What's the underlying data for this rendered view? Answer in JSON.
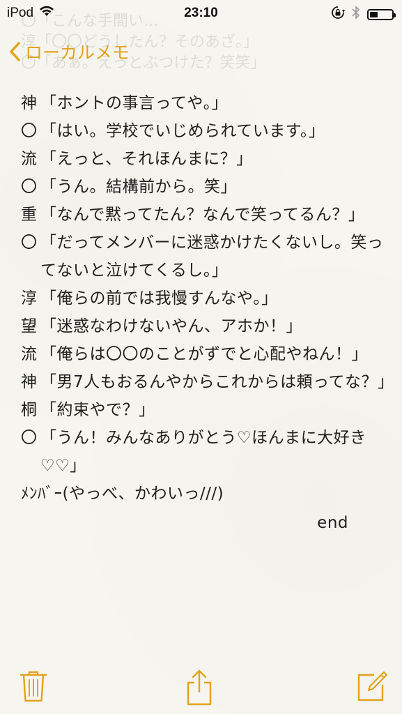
{
  "status_bar": {
    "device": "iPod",
    "time": "23:10",
    "battery_level": 0.35,
    "wifi_icon": "wifi-icon",
    "rotation_lock_icon": "rotation-lock-icon",
    "bluetooth_icon": "bluetooth-icon",
    "battery_icon": "battery-icon"
  },
  "nav": {
    "back_label": "ローカルメモ",
    "accent_color": "#e2a31b"
  },
  "ghost_lines": [
    "〇「こんな手間い…",
    "淳「〇〇どうしたん？そのあざ。」",
    "〇「あぁ。えっとぶつけた？笑笑」"
  ],
  "note": {
    "lines": [
      {
        "speaker": "神",
        "text": "「ホントの事言ってや。」"
      },
      {
        "speaker": "〇",
        "text": "「はい。学校でいじめられています。」"
      },
      {
        "speaker": "流",
        "text": "「えっと、それほんまに？」"
      },
      {
        "speaker": "〇",
        "text": "「うん。結構前から。笑」"
      },
      {
        "speaker": "重",
        "text": "「なんで黙ってたん？なんで笑ってるん？」"
      },
      {
        "speaker": "〇",
        "text": "「だってメンバーに迷惑かけたくないし。笑ってないと泣けてくるし。」"
      },
      {
        "speaker": "淳",
        "text": "「俺らの前では我慢すんなや。」"
      },
      {
        "speaker": "望",
        "text": "「迷惑なわけないやん、アホか！」"
      },
      {
        "speaker": "流",
        "text": "「俺らは〇〇のことがずでと心配やねん！」"
      },
      {
        "speaker": "神",
        "text": "「男7人もおるんやからこれからは頼ってな？」"
      },
      {
        "speaker": "桐",
        "text": "「約束やで？」"
      },
      {
        "speaker": "〇",
        "text": "「うん！みんなありがとう♡ほんまに大好き♡♡」"
      }
    ],
    "closing": "ﾒﾝﾊﾞｰ(やっべ、かわいっ///)",
    "end": "end"
  },
  "toolbar": {
    "trash_icon": "trash-icon",
    "share_icon": "share-icon",
    "compose_icon": "compose-icon"
  }
}
